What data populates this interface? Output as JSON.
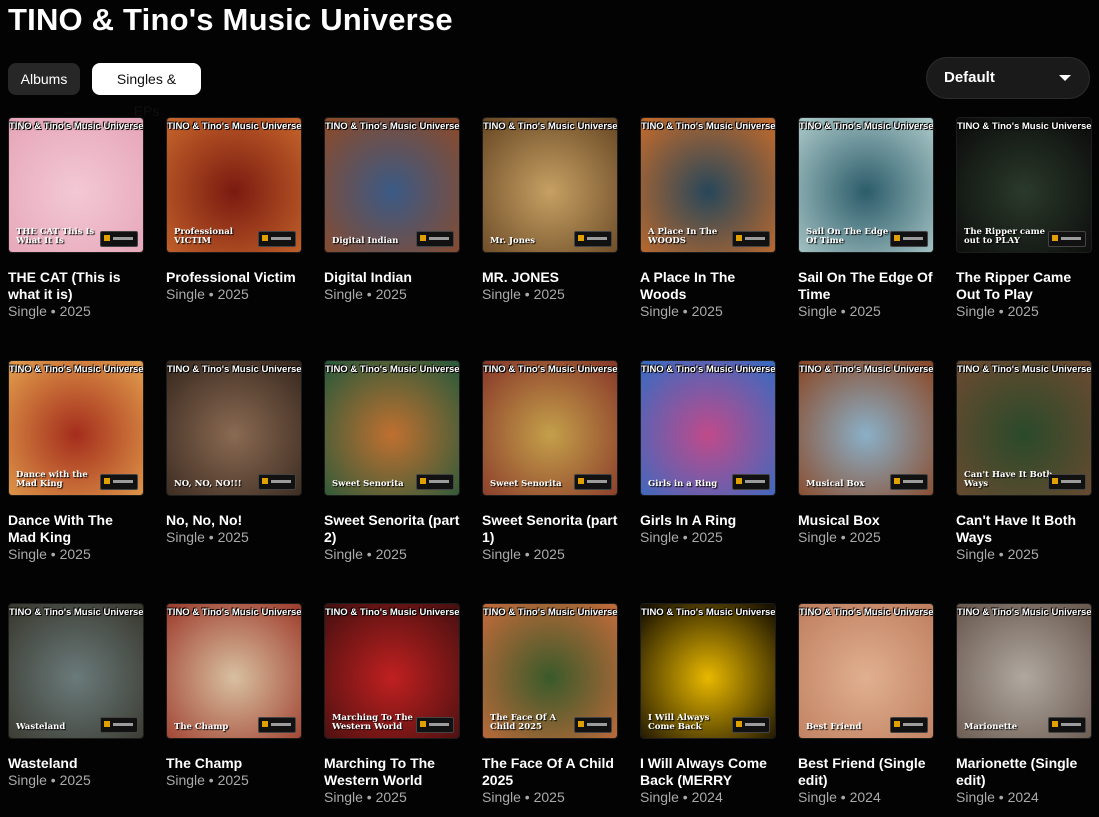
{
  "page": {
    "title": "TINO & Tino's Music Universe"
  },
  "filters": {
    "chips": [
      "Albums",
      "Singles & EPs"
    ],
    "active": "Singles & EPs"
  },
  "sort": {
    "selected": "Default"
  },
  "artist_banner": "TINO & Tino's Music Universe",
  "releases": [
    {
      "title": "THE CAT (This is what it is)",
      "meta": "Single • 2025",
      "caption": "THE CAT This Is What It Is",
      "colors": [
        "#f3c8d4",
        "#e6a6b9"
      ]
    },
    {
      "title": "Professional Victim",
      "meta": "Single • 2025",
      "caption": "Professional VICTIM",
      "colors": [
        "#7a1a10",
        "#c4632a"
      ]
    },
    {
      "title": "Digital Indian",
      "meta": "Single • 2025",
      "caption": "Digital Indian",
      "colors": [
        "#3a5a86",
        "#8a4a2a"
      ]
    },
    {
      "title": "MR. JONES",
      "meta": "Single • 2025",
      "caption": "Mr. Jones",
      "colors": [
        "#c6a063",
        "#6b4a26"
      ]
    },
    {
      "title": "A Place In The Woods",
      "meta": "Single • 2025",
      "caption": "A Place In The WOODS",
      "colors": [
        "#27475a",
        "#c06a2c"
      ]
    },
    {
      "title": "Sail On The Edge Of Time",
      "meta": "Single • 2025",
      "caption": "Sail On The Edge Of Time",
      "colors": [
        "#2c5c6a",
        "#a8c6c6"
      ]
    },
    {
      "title": "The Ripper Came Out To Play",
      "meta": "Single • 2025",
      "caption": "The Ripper came out to PLAY",
      "colors": [
        "#2a3a2a",
        "#0c0c0c"
      ]
    },
    {
      "title": "Dance With The Mad King",
      "meta": "Single • 2025",
      "caption": "Dance with the Mad King",
      "colors": [
        "#a42d1c",
        "#e09a4a"
      ]
    },
    {
      "title": "No, No, No!",
      "meta": "Single • 2025",
      "caption": "NO, NO, NO!!!",
      "colors": [
        "#8a6a52",
        "#3a2a20"
      ]
    },
    {
      "title": "Sweet Senorita (part 2)",
      "meta": "Single • 2025",
      "caption": "Sweet Senorita",
      "colors": [
        "#c07030",
        "#2c5a3a"
      ]
    },
    {
      "title": "Sweet Senorita (part 1)",
      "meta": "Single • 2025",
      "caption": "Sweet Senorita",
      "colors": [
        "#c4a04a",
        "#8a3a2a"
      ]
    },
    {
      "title": "Girls In A Ring",
      "meta": "Single • 2025",
      "caption": "Girls in a Ring",
      "colors": [
        "#c04a8a",
        "#3a6ac0"
      ]
    },
    {
      "title": "Musical Box",
      "meta": "Single • 2025",
      "caption": "Musical Box",
      "colors": [
        "#8ab0c8",
        "#8a4a2a"
      ]
    },
    {
      "title": "Can't Have It Both Ways",
      "meta": "Single • 2025",
      "caption": "Can't Have It Both Ways",
      "colors": [
        "#2a4a2a",
        "#6a4a30"
      ]
    },
    {
      "title": "Wasteland",
      "meta": "Single • 2025",
      "caption": "Wasteland",
      "colors": [
        "#6a7a7a",
        "#3a3a30"
      ]
    },
    {
      "title": "The Champ",
      "meta": "Single • 2025",
      "caption": "The Champ",
      "colors": [
        "#d8c0a0",
        "#a04030"
      ]
    },
    {
      "title": "Marching To The Western World",
      "meta": "Single • 2025",
      "caption": "Marching To The Western World",
      "colors": [
        "#c02020",
        "#4a1010"
      ]
    },
    {
      "title": "The Face Of A Child 2025",
      "meta": "Single • 2025",
      "caption": "The Face Of A Child 2025",
      "colors": [
        "#3a5a2a",
        "#c06a3a"
      ]
    },
    {
      "title": "I Will Always Come Back (MERRY",
      "meta": "Single • 2024",
      "caption": "I Will Always Come Back",
      "colors": [
        "#e8b800",
        "#1a1200"
      ]
    },
    {
      "title": "Best Friend (Single edit)",
      "meta": "Single • 2024",
      "caption": "Best Friend",
      "colors": [
        "#e0b090",
        "#c08060"
      ]
    },
    {
      "title": "Marionette (Single edit)",
      "meta": "Single • 2024",
      "caption": "Marionette",
      "colors": [
        "#b0a8a0",
        "#6a5a50"
      ]
    }
  ]
}
